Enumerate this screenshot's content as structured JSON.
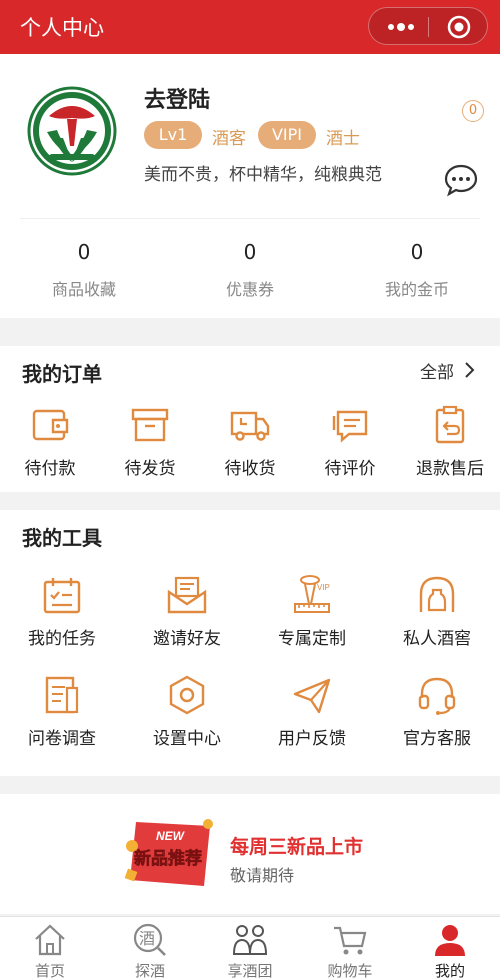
{
  "header": {
    "title": "个人中心"
  },
  "profile": {
    "name": "去登陆",
    "level_badge": "Lv1",
    "level_title": "酒客",
    "vip_badge": "VIPI",
    "vip_title": "酒士",
    "slogan": "美而不贵，杯中精华，纯粮典范",
    "message_count": "0"
  },
  "stats": [
    {
      "value": "0",
      "label": "商品收藏"
    },
    {
      "value": "0",
      "label": "优惠券"
    },
    {
      "value": "0",
      "label": "我的金币"
    }
  ],
  "orders": {
    "title": "我的订单",
    "more": "全部",
    "items": [
      {
        "label": "待付款",
        "icon": "wallet-icon"
      },
      {
        "label": "待发货",
        "icon": "box-icon"
      },
      {
        "label": "待收货",
        "icon": "truck-icon"
      },
      {
        "label": "待评价",
        "icon": "comment-icon"
      },
      {
        "label": "退款售后",
        "icon": "refund-icon"
      }
    ]
  },
  "tools": {
    "title": "我的工具",
    "items": [
      {
        "label": "我的任务",
        "icon": "calendar-task-icon"
      },
      {
        "label": "邀请好友",
        "icon": "invite-envelope-icon"
      },
      {
        "label": "专属定制",
        "icon": "vip-custom-icon"
      },
      {
        "label": "私人酒窖",
        "icon": "wine-cellar-icon"
      },
      {
        "label": "问卷调查",
        "icon": "survey-icon"
      },
      {
        "label": "设置中心",
        "icon": "settings-icon"
      },
      {
        "label": "用户反馈",
        "icon": "paper-plane-icon"
      },
      {
        "label": "官方客服",
        "icon": "headset-icon"
      }
    ]
  },
  "banner": {
    "badge_top": "NEW",
    "badge_main": "新品推荐",
    "title": "每周三新品上市",
    "subtitle": "敬请期待"
  },
  "tabbar": [
    {
      "label": "首页",
      "icon": "home-icon"
    },
    {
      "label": "探酒",
      "icon": "explore-wine-icon",
      "glyph": "酒"
    },
    {
      "label": "享酒团",
      "icon": "group-icon"
    },
    {
      "label": "购物车",
      "icon": "cart-icon"
    },
    {
      "label": "我的",
      "icon": "user-icon",
      "active": true
    }
  ],
  "colors": {
    "brand_red": "#d8282a",
    "accent_orange": "#e08a40",
    "badge_tan": "#e6ad78"
  }
}
